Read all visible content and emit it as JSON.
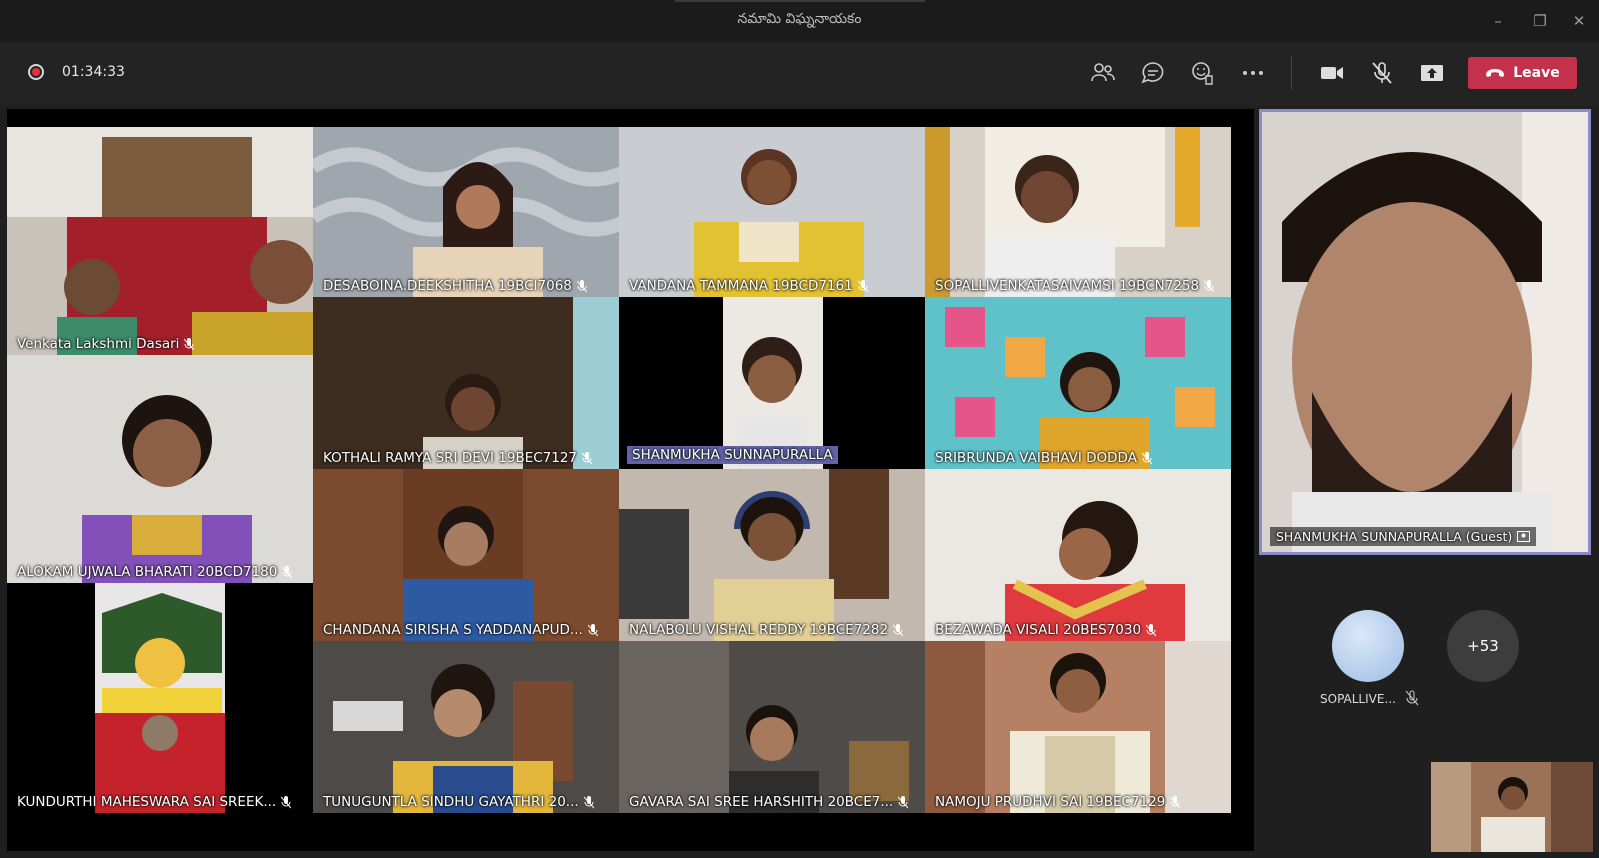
{
  "window": {
    "title": "నమామి విఘ్ననాయకం"
  },
  "toolbar": {
    "timer": "01:34:33",
    "leave_label": "Leave",
    "icons": [
      "participants-icon",
      "chat-icon",
      "reactions-icon",
      "more-options-icon",
      "camera-icon",
      "mic-muted-icon",
      "share-screen-icon",
      "phone-hangup-icon"
    ]
  },
  "tiles": [
    {
      "name": "Venkata Lakshmi Dasari",
      "muted": true
    },
    {
      "name": "DESABOINA.DEEKSHITHA 19BCI7068",
      "muted": true
    },
    {
      "name": "VANDANA TAMMANA 19BCD7161",
      "muted": true
    },
    {
      "name": "SOPALLIVENKATASAIVAMSI 19BCN7258",
      "muted": true
    },
    {
      "name": "KOTHALI RAMYA SRI DEVI 19BEC7127",
      "muted": true
    },
    {
      "name": "SHANMUKHA SUNNAPURALLA",
      "muted": false,
      "highlighted": true
    },
    {
      "name": "SRIBRUNDA VAIBHAVI DODDA",
      "muted": true
    },
    {
      "name": "ALOKAM UJWALA BHARATI 20BCD7180",
      "muted": true
    },
    {
      "name": "CHANDANA SIRISHA S YADDANAPUD...",
      "muted": true
    },
    {
      "name": "NALABOLU VISHAL REDDY 19BCE7282",
      "muted": true
    },
    {
      "name": "BEZAWADA VISALI 20BES7030",
      "muted": true
    },
    {
      "name": "KUNDURTHI MAHESWARA SAI SREEK...",
      "muted": true
    },
    {
      "name": "TUNUGUNTLA SINDHU GAYATHRI 20...",
      "muted": true
    },
    {
      "name": "GAVARA SAI SREE HARSHITH 20BCE7...",
      "muted": true
    },
    {
      "name": "NAMOJU PRUDHVI SAI 19BEC7129",
      "muted": true
    }
  ],
  "spotlight": {
    "name": "SHANMUKHA SUNNAPURALLA (Guest)"
  },
  "roster": {
    "avatar_name": "SOPALLIVE...",
    "overflow_count": "+53"
  },
  "colors": {
    "leave": "#c4314b",
    "highlight": "#6264a7",
    "spotlight_border": "#8b8cc7"
  }
}
